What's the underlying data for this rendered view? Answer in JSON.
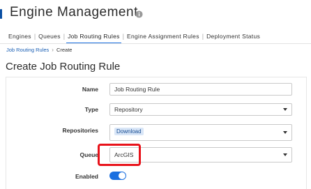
{
  "app": {
    "title": "Engine Management"
  },
  "tabs": [
    {
      "label": "Engines"
    },
    {
      "label": "Queues"
    },
    {
      "label": "Job Routing Rules",
      "active": true
    },
    {
      "label": "Engine Assignment Rules"
    },
    {
      "label": "Deployment Status"
    }
  ],
  "breadcrumb": {
    "link": "Job Routing Rules",
    "current": "Create"
  },
  "page": {
    "title": "Create Job Routing Rule"
  },
  "form": {
    "name": {
      "label": "Name",
      "value": "Job Routing Rule"
    },
    "type": {
      "label": "Type",
      "value": "Repository"
    },
    "repositories": {
      "label": "Repositories",
      "chip": "Download"
    },
    "queue": {
      "label": "Queue",
      "value": "ArcGIS"
    },
    "enabled": {
      "label": "Enabled",
      "on": true
    }
  },
  "colors": {
    "accent": "#1a6fe0",
    "link": "#1a5fb4",
    "highlight": "#e8121a"
  },
  "icons": {
    "info": "info-icon",
    "dropdown": "chevron-down-icon",
    "breadcrumb_separator": "chevron-right-icon"
  }
}
